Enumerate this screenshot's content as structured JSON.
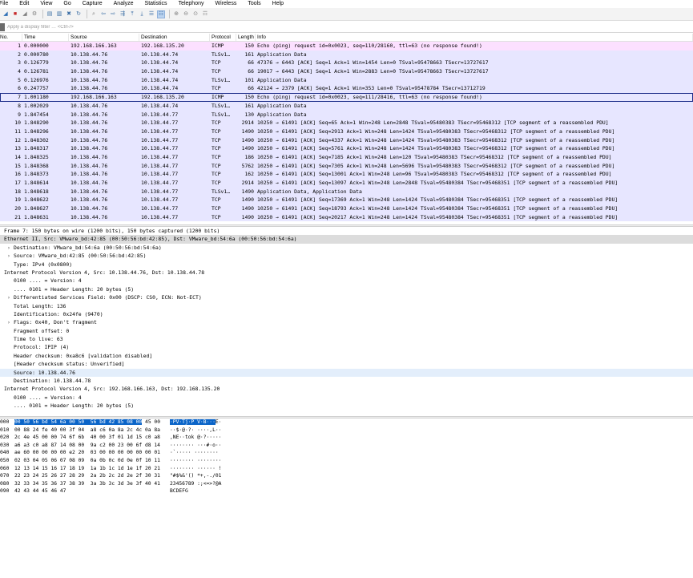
{
  "menu": [
    "File",
    "Edit",
    "View",
    "Go",
    "Capture",
    "Analyze",
    "Statistics",
    "Telephony",
    "Wireless",
    "Tools",
    "Help"
  ],
  "toolbar": {
    "icons": [
      {
        "name": "shark-fin-start-icon",
        "glyph": "◢",
        "cls": "fin"
      },
      {
        "name": "stop-capture-icon",
        "glyph": "■",
        "cls": "stop"
      },
      {
        "name": "restart-capture-icon",
        "glyph": "◢",
        "cls": "gray"
      },
      {
        "name": "capture-options-icon",
        "glyph": "⚙",
        "cls": "gray"
      },
      {
        "sep": true
      },
      {
        "name": "open-file-icon",
        "glyph": "▤",
        "cls": ""
      },
      {
        "name": "save-file-icon",
        "glyph": "▥",
        "cls": ""
      },
      {
        "name": "close-file-icon",
        "glyph": "✖",
        "cls": ""
      },
      {
        "name": "reload-icon",
        "glyph": "↻",
        "cls": ""
      },
      {
        "sep": true
      },
      {
        "name": "find-packet-icon",
        "glyph": "⌕",
        "cls": "gray"
      },
      {
        "name": "go-back-icon",
        "glyph": "⇦",
        "cls": ""
      },
      {
        "name": "go-forward-icon",
        "glyph": "⇨",
        "cls": ""
      },
      {
        "name": "go-to-packet-icon",
        "glyph": "⇶",
        "cls": ""
      },
      {
        "name": "first-packet-icon",
        "glyph": "⤒",
        "cls": ""
      },
      {
        "name": "last-packet-icon",
        "glyph": "⤓",
        "cls": ""
      },
      {
        "name": "autoscroll-icon",
        "glyph": "☰",
        "cls": ""
      },
      {
        "name": "colorize-icon",
        "glyph": "☷",
        "cls": "sel"
      },
      {
        "sep": true
      },
      {
        "name": "zoom-in-icon",
        "glyph": "⊕",
        "cls": "gray"
      },
      {
        "name": "zoom-out-icon",
        "glyph": "⊖",
        "cls": "gray"
      },
      {
        "name": "normal-size-icon",
        "glyph": "⊙",
        "cls": "gray"
      },
      {
        "name": "resize-columns-icon",
        "glyph": "☶",
        "cls": "gray"
      }
    ]
  },
  "filter": {
    "placeholder": "Apply a display filter … <Ctrl-/>"
  },
  "columns": {
    "no": "No.",
    "time": "Time",
    "src": "Source",
    "dst": "Destination",
    "proto": "Protocol",
    "len": "Length",
    "info": "Info"
  },
  "packets": [
    {
      "no": "1",
      "time": "0.000000",
      "src": "192.168.166.163",
      "dst": "192.168.135.20",
      "proto": "ICMP",
      "len": "150",
      "info": "Echo (ping) request  id=0x0023, seq=110/28160, ttl=63 (no response found!)",
      "kind": "icmp"
    },
    {
      "no": "2",
      "time": "0.000780",
      "src": "10.138.44.76",
      "dst": "10.138.44.74",
      "proto": "TLSv1…",
      "len": "161",
      "info": "Application Data",
      "kind": "tcp"
    },
    {
      "no": "3",
      "time": "0.126779",
      "src": "10.138.44.76",
      "dst": "10.138.44.74",
      "proto": "TCP",
      "len": "66",
      "info": "47376 → 6443 [ACK] Seq=1 Ack=1 Win=1454 Len=0 TSval=95478663 TSecr=13727617",
      "kind": "tcp"
    },
    {
      "no": "4",
      "time": "0.126781",
      "src": "10.138.44.76",
      "dst": "10.138.44.74",
      "proto": "TCP",
      "len": "66",
      "info": "19017 → 6443 [ACK] Seq=1 Ack=1 Win=2883 Len=0 TSval=95478663 TSecr=13727617",
      "kind": "tcp"
    },
    {
      "no": "5",
      "time": "0.126976",
      "src": "10.138.44.76",
      "dst": "10.138.44.74",
      "proto": "TLSv1…",
      "len": "101",
      "info": "Application Data",
      "kind": "tcp"
    },
    {
      "no": "6",
      "time": "0.247757",
      "src": "10.138.44.76",
      "dst": "10.138.44.74",
      "proto": "TCP",
      "len": "66",
      "info": "42124 → 2379 [ACK] Seq=1 Ack=1 Win=353 Len=0 TSval=95478784 TSecr=13712719",
      "kind": "tcp"
    },
    {
      "no": "7",
      "time": "1.001180",
      "src": "192.168.166.163",
      "dst": "192.168.135.20",
      "proto": "ICMP",
      "len": "150",
      "info": "Echo (ping) request  id=0x0023, seq=111/28416, ttl=63 (no response found!)",
      "kind": "sel"
    },
    {
      "no": "8",
      "time": "1.002029",
      "src": "10.138.44.76",
      "dst": "10.138.44.74",
      "proto": "TLSv1…",
      "len": "161",
      "info": "Application Data",
      "kind": "tcp"
    },
    {
      "no": "9",
      "time": "1.847454",
      "src": "10.138.44.76",
      "dst": "10.138.44.77",
      "proto": "TLSv1…",
      "len": "130",
      "info": "Application Data",
      "kind": "tcp"
    },
    {
      "no": "10",
      "time": "1.848290",
      "src": "10.138.44.76",
      "dst": "10.138.44.77",
      "proto": "TCP",
      "len": "2914",
      "info": "10250 → 61491 [ACK] Seq=65 Ack=1 Win=248 Len=2848 TSval=95480383 TSecr=95468312 [TCP segment of a reassembled PDU]",
      "kind": "tcp"
    },
    {
      "no": "11",
      "time": "1.848296",
      "src": "10.138.44.76",
      "dst": "10.138.44.77",
      "proto": "TCP",
      "len": "1490",
      "info": "10250 → 61491 [ACK] Seq=2913 Ack=1 Win=248 Len=1424 TSval=95480383 TSecr=95468312 [TCP segment of a reassembled PDU]",
      "kind": "tcp"
    },
    {
      "no": "12",
      "time": "1.848302",
      "src": "10.138.44.76",
      "dst": "10.138.44.77",
      "proto": "TCP",
      "len": "1490",
      "info": "10250 → 61491 [ACK] Seq=4337 Ack=1 Win=248 Len=1424 TSval=95480383 TSecr=95468312 [TCP segment of a reassembled PDU]",
      "kind": "tcp"
    },
    {
      "no": "13",
      "time": "1.848317",
      "src": "10.138.44.76",
      "dst": "10.138.44.77",
      "proto": "TCP",
      "len": "1490",
      "info": "10250 → 61491 [ACK] Seq=5761 Ack=1 Win=248 Len=1424 TSval=95480383 TSecr=95468312 [TCP segment of a reassembled PDU]",
      "kind": "tcp"
    },
    {
      "no": "14",
      "time": "1.848325",
      "src": "10.138.44.76",
      "dst": "10.138.44.77",
      "proto": "TCP",
      "len": "186",
      "info": "10250 → 61491 [ACK] Seq=7185 Ack=1 Win=248 Len=120 TSval=95480383 TSecr=95468312 [TCP segment of a reassembled PDU]",
      "kind": "tcp"
    },
    {
      "no": "15",
      "time": "1.848368",
      "src": "10.138.44.76",
      "dst": "10.138.44.77",
      "proto": "TCP",
      "len": "5762",
      "info": "10250 → 61491 [ACK] Seq=7305 Ack=1 Win=248 Len=5696 TSval=95480383 TSecr=95468312 [TCP segment of a reassembled PDU]",
      "kind": "tcp"
    },
    {
      "no": "16",
      "time": "1.848373",
      "src": "10.138.44.76",
      "dst": "10.138.44.77",
      "proto": "TCP",
      "len": "162",
      "info": "10250 → 61491 [ACK] Seq=13001 Ack=1 Win=248 Len=96 TSval=95480383 TSecr=95468312 [TCP segment of a reassembled PDU]",
      "kind": "tcp"
    },
    {
      "no": "17",
      "time": "1.848614",
      "src": "10.138.44.76",
      "dst": "10.138.44.77",
      "proto": "TCP",
      "len": "2914",
      "info": "10250 → 61491 [ACK] Seq=13097 Ack=1 Win=248 Len=2848 TSval=95480384 TSecr=95468351 [TCP segment of a reassembled PDU]",
      "kind": "tcp"
    },
    {
      "no": "18",
      "time": "1.848618",
      "src": "10.138.44.76",
      "dst": "10.138.44.77",
      "proto": "TLSv1…",
      "len": "1490",
      "info": "Application Data, Application Data",
      "kind": "tcp"
    },
    {
      "no": "19",
      "time": "1.848622",
      "src": "10.138.44.76",
      "dst": "10.138.44.77",
      "proto": "TCP",
      "len": "1490",
      "info": "10250 → 61491 [ACK] Seq=17369 Ack=1 Win=248 Len=1424 TSval=95480384 TSecr=95468351 [TCP segment of a reassembled PDU]",
      "kind": "tcp"
    },
    {
      "no": "20",
      "time": "1.848627",
      "src": "10.138.44.76",
      "dst": "10.138.44.77",
      "proto": "TCP",
      "len": "1490",
      "info": "10250 → 61491 [ACK] Seq=18793 Ack=1 Win=248 Len=1424 TSval=95480384 TSecr=95468351 [TCP segment of a reassembled PDU]",
      "kind": "tcp"
    },
    {
      "no": "21",
      "time": "1.848631",
      "src": "10.138.44.76",
      "dst": "10.138.44.77",
      "proto": "TCP",
      "len": "1490",
      "info": "10250 → 61491 [ACK] Seq=20217 Ack=1 Win=248 Len=1424 TSval=95480384 TSecr=95468351 [TCP segment of a reassembled PDU]",
      "kind": "tcp"
    }
  ],
  "details": [
    {
      "text": "Frame 7: 150 bytes on wire (1200 bits), 150 bytes captured (1200 bits)",
      "lvl": "l0",
      "tw": "",
      "cls": ""
    },
    {
      "text": "Ethernet II, Src: VMware_bd:42:85 (00:50:56:bd:42:85), Dst: VMware_bd:54:6a (00:50:56:bd:54:6a)",
      "lvl": "l0",
      "tw": "",
      "cls": "sel"
    },
    {
      "text": "Destination: VMware_bd:54:6a (00:50:56:bd:54:6a)",
      "lvl": "l1x",
      "tw": "›",
      "cls": ""
    },
    {
      "text": "Source: VMware_bd:42:85 (00:50:56:bd:42:85)",
      "lvl": "l1x",
      "tw": "›",
      "cls": ""
    },
    {
      "text": "Type: IPv4 (0x0800)",
      "lvl": "l1",
      "tw": "",
      "cls": ""
    },
    {
      "text": "Internet Protocol Version 4, Src: 10.138.44.76, Dst: 10.138.44.78",
      "lvl": "l0",
      "tw": "",
      "cls": ""
    },
    {
      "text": "0100 .... = Version: 4",
      "lvl": "l1",
      "tw": "",
      "cls": ""
    },
    {
      "text": ".... 0101 = Header Length: 20 bytes (5)",
      "lvl": "l1",
      "tw": "",
      "cls": ""
    },
    {
      "text": "Differentiated Services Field: 0x00 (DSCP: CS0, ECN: Not-ECT)",
      "lvl": "l1x",
      "tw": "›",
      "cls": ""
    },
    {
      "text": "Total Length: 136",
      "lvl": "l1",
      "tw": "",
      "cls": ""
    },
    {
      "text": "Identification: 0x24fe (9470)",
      "lvl": "l1",
      "tw": "",
      "cls": ""
    },
    {
      "text": "Flags: 0x40, Don't fragment",
      "lvl": "l1x",
      "tw": "›",
      "cls": ""
    },
    {
      "text": "Fragment offset: 0",
      "lvl": "l1",
      "tw": "",
      "cls": ""
    },
    {
      "text": "Time to live: 63",
      "lvl": "l1",
      "tw": "",
      "cls": ""
    },
    {
      "text": "Protocol: IPIP (4)",
      "lvl": "l1",
      "tw": "",
      "cls": ""
    },
    {
      "text": "Header checksum: 0xa8c6 [validation disabled]",
      "lvl": "l1",
      "tw": "",
      "cls": ""
    },
    {
      "text": "[Header checksum status: Unverified]",
      "lvl": "l1",
      "tw": "",
      "cls": ""
    },
    {
      "text": "Source: 10.138.44.76",
      "lvl": "l1",
      "tw": "",
      "cls": "hl"
    },
    {
      "text": "Destination: 10.138.44.78",
      "lvl": "l1",
      "tw": "",
      "cls": ""
    },
    {
      "text": "Internet Protocol Version 4, Src: 192.168.166.163, Dst: 192.168.135.20",
      "lvl": "l0",
      "tw": "",
      "cls": ""
    },
    {
      "text": "0100 .... = Version: 4",
      "lvl": "l1",
      "tw": "",
      "cls": ""
    },
    {
      "text": ".... 0101 = Header Length: 20 bytes (5)",
      "lvl": "l1",
      "tw": "",
      "cls": ""
    }
  ],
  "bytes": [
    {
      "off": "000",
      "pre": "",
      "hl": "00 50 56 bd 54 6a 00 50  56 bd 42 85 08 00",
      "post": " 45 00",
      "apre": "",
      "ahl": "·PV·Tj·P V·B···",
      "apost": "E·"
    },
    {
      "off": "010",
      "pre": "00 88 24 fe 40 00 3f 04  a8 c6 0a 8a 2c 4c 0a 8a",
      "hl": "",
      "post": "",
      "apre": "··$·@·?· ····,L··",
      "ahl": "",
      "apost": ""
    },
    {
      "off": "020",
      "pre": "2c 4e 45 00 00 74 6f 6b  40 00 3f 01 1d 15 c0 a8",
      "hl": "",
      "post": "",
      "apre": ",NE··tok @·?·····",
      "ahl": "",
      "apost": ""
    },
    {
      "off": "030",
      "pre": "a6 a3 c0 a8 87 14 08 00  9a c2 00 23 00 6f d8 14",
      "hl": "",
      "post": "",
      "apre": "········ ···#·o··",
      "ahl": "",
      "apost": ""
    },
    {
      "off": "040",
      "pre": "ae 60 00 00 00 00 e2 20  03 00 00 00 00 00 00 01",
      "hl": "",
      "post": "",
      "apre": "·`····· ········",
      "ahl": "",
      "apost": ""
    },
    {
      "off": "050",
      "pre": "02 03 04 05 06 07 08 09  0a 0b 0c 0d 0e 0f 10 11",
      "hl": "",
      "post": "",
      "apre": "········ ········",
      "ahl": "",
      "apost": ""
    },
    {
      "off": "060",
      "pre": "12 13 14 15 16 17 18 19  1a 1b 1c 1d 1e 1f 20 21",
      "hl": "",
      "post": "",
      "apre": "········ ······ !",
      "ahl": "",
      "apost": ""
    },
    {
      "off": "070",
      "pre": "22 23 24 25 26 27 28 29  2a 2b 2c 2d 2e 2f 30 31",
      "hl": "",
      "post": "",
      "apre": "\"#$%&'() *+,-./01",
      "ahl": "",
      "apost": ""
    },
    {
      "off": "080",
      "pre": "32 33 34 35 36 37 38 39  3a 3b 3c 3d 3e 3f 40 41",
      "hl": "",
      "post": "",
      "apre": "23456789 :;<=>?@A",
      "ahl": "",
      "apost": ""
    },
    {
      "off": "090",
      "pre": "42 43 44 45 46 47",
      "hl": "",
      "post": "",
      "apre": "BCDEFG",
      "ahl": "",
      "apost": ""
    }
  ]
}
